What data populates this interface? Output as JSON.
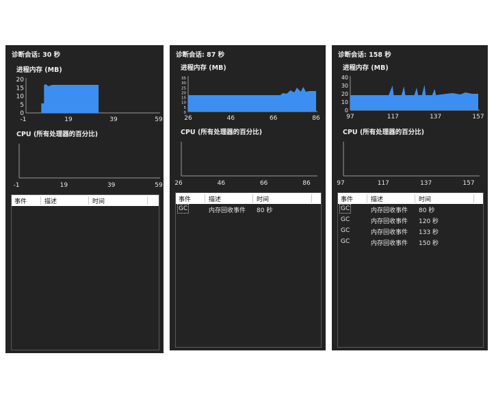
{
  "panels": [
    {
      "session_label": "诊断会话: 30 秒",
      "memory_title": "进程内存 (MB)",
      "cpu_title": "CPU (所有处理器的百分比)",
      "memory_chart": {
        "y_ticks": [
          "20",
          "15",
          "10",
          "5",
          "0"
        ],
        "x_ticks": [
          "-1",
          "19",
          "39",
          "59"
        ],
        "color": "#3c8ff0"
      },
      "cpu_chart": {
        "x_ticks": [
          "-1",
          "19",
          "39",
          "59"
        ]
      },
      "table": {
        "columns": [
          "事件",
          "描述",
          "时间"
        ],
        "rows": []
      }
    },
    {
      "session_label": "诊断会话: 87 秒",
      "memory_title": "进程内存 (MB)",
      "cpu_title": "CPU (所有处理器的百分比)",
      "memory_chart": {
        "y_ticks": [
          "35",
          "30",
          "25",
          "20",
          "15",
          "10",
          "5",
          "0"
        ],
        "x_ticks": [
          "26",
          "46",
          "66",
          "86"
        ],
        "color": "#3c8ff0"
      },
      "cpu_chart": {
        "x_ticks": [
          "26",
          "46",
          "66",
          "86"
        ]
      },
      "table": {
        "columns": [
          "事件",
          "描述",
          "时间"
        ],
        "rows": [
          {
            "event": "GC",
            "description": "内存回收事件",
            "time": "80 秒"
          }
        ]
      }
    },
    {
      "session_label": "诊断会话: 158 秒",
      "memory_title": "进程内存 (MB)",
      "cpu_title": "CPU (所有处理器的百分比)",
      "memory_chart": {
        "y_ticks": [
          "40",
          "30",
          "20",
          "10",
          "0"
        ],
        "x_ticks": [
          "97",
          "117",
          "137",
          "157"
        ],
        "color": "#3c8ff0"
      },
      "cpu_chart": {
        "x_ticks": [
          "97",
          "117",
          "137",
          "157"
        ]
      },
      "table": {
        "columns": [
          "事件",
          "描述",
          "时间"
        ],
        "rows": [
          {
            "event": "GC",
            "description": "内存回收事件",
            "time": "80 秒"
          },
          {
            "event": "GC",
            "description": "内存回收事件",
            "time": "120 秒"
          },
          {
            "event": "GC",
            "description": "内存回收事件",
            "time": "133 秒"
          },
          {
            "event": "GC",
            "description": "内存回收事件",
            "time": "150 秒"
          }
        ]
      }
    }
  ]
}
